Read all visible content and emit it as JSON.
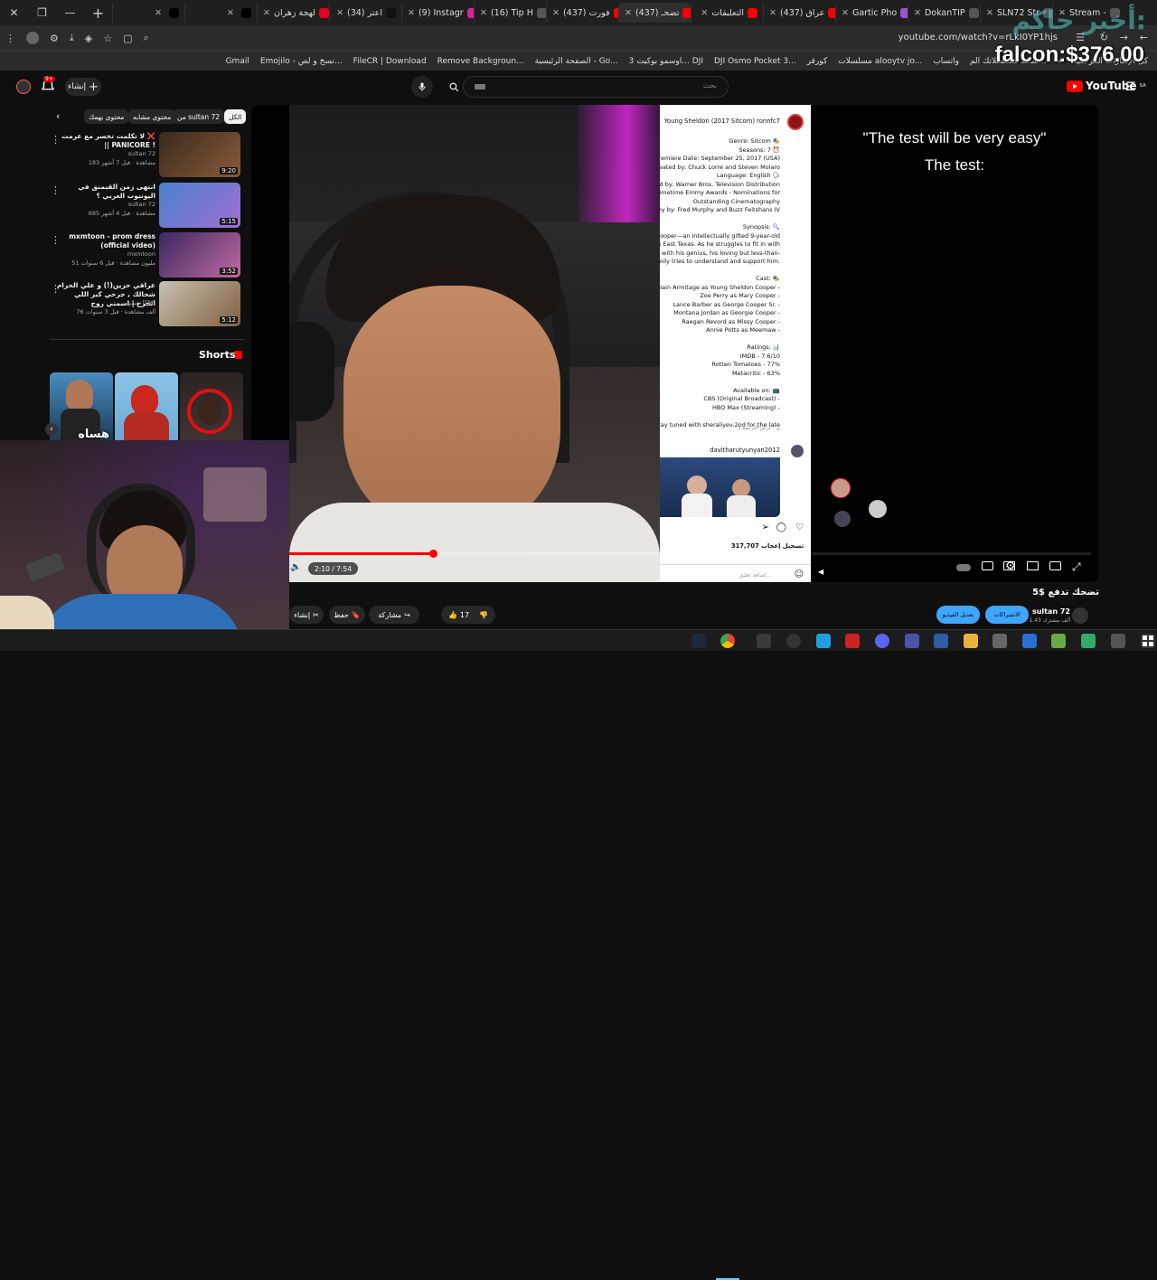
{
  "browser": {
    "tabs": [
      {
        "label": "",
        "favicon": "twitter-x"
      },
      {
        "label": "",
        "favicon": "twitter-x"
      },
      {
        "label": "لهجة زهران",
        "favicon": "pinterest"
      },
      {
        "label": "(34) اعتر",
        "favicon": "tiktok"
      },
      {
        "label": "(9) Instagr",
        "favicon": "instagram"
      },
      {
        "label": "(16) Tip H",
        "favicon": "app"
      },
      {
        "label": "(437) فورت",
        "favicon": "youtube"
      },
      {
        "label": "(437) تضحـ",
        "favicon": "youtube"
      },
      {
        "label": "التعليقات",
        "favicon": "youtube"
      },
      {
        "label": "(437) عراق",
        "favicon": "youtube"
      },
      {
        "label": "Gartic Pho",
        "favicon": "gartic"
      },
      {
        "label": "DokanTIP",
        "favicon": "app"
      },
      {
        "label": "SLN72 Str",
        "favicon": "app"
      },
      {
        "label": "Stream -",
        "favicon": "app"
      }
    ],
    "url": "youtube.com/watch?v=rLkI0YP1hjs",
    "bookmarks": [
      "Gmail",
      "Emojilo - نسخ و لص...",
      "FileCR | Download",
      "Remove Backgroun...",
      "الصفحة الرئيسية - Go...",
      "اوسمو بوكيت 3... DJI",
      "DJI Osmo Pocket 3...",
      "كورقر",
      "مسلسلات alooytv jo...",
      "واتساب",
      "شاهد مسلسلاتك الم...",
      "كل الإشارات المرجعية"
    ]
  },
  "overlay": {
    "price": "falcon:$376.00",
    "logo_text": "أخبر حاكم:"
  },
  "youtube": {
    "logo": "YouTube",
    "logo_region": "SA",
    "search_placeholder": "بحث",
    "create_label": "إنشاء",
    "notification_count": "9+",
    "chips": [
      "الكل",
      "من sultan 72",
      "محتوى مشابه",
      "محتوى يهمك"
    ],
    "recommendations": [
      {
        "title": "لا تكلمت تخسر مع عرمت ❌ || PANICORE !",
        "channel": "sultan 72",
        "meta": "183 مشاهدة · قبل 7 أشهر",
        "duration": "9:20"
      },
      {
        "title": "انتهى زمن القيمنق في اليوتيوب العربي ؟",
        "channel": "sultan 72",
        "meta": "685 مشاهدة · قبل 4 أشهر",
        "duration": "5:15"
      },
      {
        "title": "mxmtoon - prom dress (official video)",
        "channel": "mxmtoon",
        "meta": "51 مليون مشاهدة · قبل 6 سنوات",
        "duration": "3:52"
      },
      {
        "title": "عراقي حزين(!) و علي الحرام شحالك , جرحي كبر اللي انجرح | اسمني روح",
        "channel": "حنيني [FM]",
        "meta": "76 ألف مشاهدة · قبل 3 سنوات",
        "duration": "5:12"
      }
    ],
    "shorts_title": "Shorts",
    "shorts": [
      {
        "label": "هساه"
      },
      {
        "label": ""
      },
      {
        "label": ""
      }
    ],
    "player": {
      "time": "2:10 / 7:54",
      "progress": 0.276,
      "test_line1": "\"The test will be very easy\"",
      "test_line2": "The test:"
    },
    "panel": {
      "header": "Young Sheldon (2017 Sitcom) ronnfc7",
      "lines": [
        "Genre: Sitcom 🎭",
        "Seasons: 7 ⏰",
        "Premiere Date: September 25, 2017 (USA)",
        "Created by: Chuck Lorre and Steven Molaro",
        "Language: English 🗣",
        "uted by: Warner Bros. Television Distribution",
        "Primetime Emmy Awards - Nominations for",
        "Outstanding Cinematography",
        "aphy by: Fred Murphy and Buzz Feitshans IV",
        "",
        "Synopsis: 🔍",
        "Cooper—an intellectually gifted 9-year-old",
        "ool in East Texas. As he struggles to fit in with",
        "up with his genius, his loving but less-than-",
        "family tries to understand and support him.",
        "",
        "Cast: 🎭",
        "Iain Armitage as Young Sheldon Cooper -",
        "Zoe Perry as Mary Cooper -",
        "Lance Barber as George Cooper Sr. -",
        "Montana Jordan as Georgie Cooper -",
        "Raegan Revord as Missy Cooper -",
        "Annie Potts as Meemaw -",
        "",
        "Ratings: 📊",
        "IMDB - 7.6/10",
        "Rotten Tomatoes - 77%",
        "Metacritic - 63%",
        "",
        "Available on: 📺",
        "CBS (Original Broadcast) -",
        "HBO Max (Streaming) -",
        "",
        "Stay tuned with sheraliyev.2nd for the late"
      ],
      "translate": "3 ي · عرض الترجمة",
      "commenter": "davitharutyunyan2012",
      "likes": "317,707 تسجيل إعجاب",
      "comment_placeholder": "إضافة تعليق..."
    },
    "video_title": "تضحك تدفع $5",
    "channel_name": "sultan 72",
    "subscribers": "1.43 ألف مشترك",
    "subscriptions_label": "الاشتراكات",
    "edit_video_label": "تعديل الفيديو",
    "like_count": "17",
    "share_label": "مشاركة",
    "save_label": "حفظ",
    "create_action_label": "إنشاء"
  },
  "colors": {
    "accent": "#ff0000",
    "background": "#0f0f0f",
    "subscribe_blue": "#3ea6ff"
  }
}
